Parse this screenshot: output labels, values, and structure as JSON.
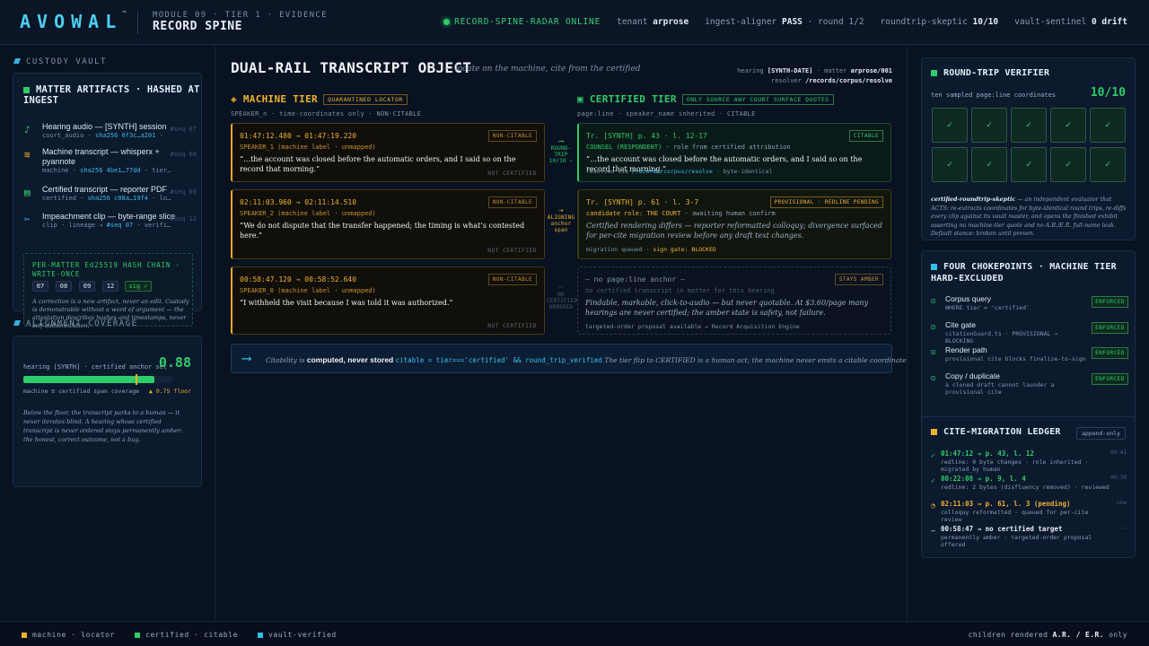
{
  "header": {
    "logo": "AVOWAL",
    "tm": "™",
    "module_line": "MODULE 09 · TIER 1 · EVIDENCE",
    "module_title": "RECORD SPINE",
    "online": "RECORD-SPINE-RADAR ONLINE",
    "tenant_label": "tenant",
    "tenant": "arprose",
    "aligner_label": "ingest-aligner",
    "aligner": "PASS",
    "round": "· round 1/2",
    "skeptic_label": "roundtrip-skeptic",
    "skeptic": "10/10",
    "sentinel_label": "vault-sentinel",
    "sentinel": "0 drift"
  },
  "left": {
    "vault_title": "CUSTODY VAULT",
    "artifacts_title": "MATTER ARTIFACTS · HASHED AT INGEST",
    "artifacts": [
      {
        "icon": "♪",
        "name": "Hearing audio — [SYNTH] session",
        "meta_pre": "court_audio · ",
        "hash": "sha256 0f3c…a201",
        "meta_post": " ·",
        "seq": "#seq 07"
      },
      {
        "icon": "≋",
        "name": "Machine transcript — whisperx + pyannote",
        "meta_pre": "machine · ",
        "hash": "sha256 4be1…77dd",
        "meta_post": " · tier…",
        "seq": "#seq 08"
      },
      {
        "icon": "▤",
        "name": "Certified transcript — reporter PDF",
        "meta_pre": "certified · ",
        "hash": "sha256 c08a…19f4",
        "meta_post": " · lo…",
        "seq": "#seq 09"
      },
      {
        "icon": "✂",
        "name": "Impeachment clip — byte-range slice",
        "meta_pre": "clip · lineage → ",
        "hash": "#seq 07",
        "meta_post": " · verifi…",
        "seq": "#seq 12"
      }
    ],
    "chain_title": "PER-MATTER Ed25519 HASH CHAIN · WRITE-ONCE",
    "chain": [
      "07",
      "08",
      "09",
      "12"
    ],
    "sig": "sig ✓",
    "chain_note": "A correction is a new artifact, never an edit. Custody is demonstrable without a word of argument — the attestation describes hashes and timestamps, never self-authentication.",
    "coverage_title": "ALIGNMENT COVERAGE",
    "coverage_label": "hearing [SYNTH] · certified anchor set",
    "coverage_value": "0.88",
    "coverage_fraction": 0.88,
    "floor_fraction": 0.75,
    "coverage_sub": "machine ≡ certified span coverage",
    "floor": "▲ 0.75 floor",
    "coverage_note": "Below the floor, the transcript parks to a human — it never iterates blind. A hearing whose certified transcript is never ordered stays permanently amber: the honest, correct outcome, not a bug."
  },
  "main": {
    "title": "DUAL-RAIL TRANSCRIPT OBJECT",
    "subtitle": "— locate on the machine, cite from the certified",
    "meta_hearing_label": "hearing",
    "meta_hearing": "[SYNTH-DATE]",
    "meta_matter_label": "· matter",
    "meta_matter": "arprose/001",
    "meta_resolver_label": "resolver",
    "meta_resolver": "/records/corpus/resolve",
    "machine_tier": "MACHINE TIER",
    "machine_tag": "QUARANTINED LOCATOR",
    "machine_sub": "SPEAKER_n · time-coordinates only · NON-CITABLE",
    "certified_tier": "CERTIFIED TIER",
    "certified_tag": "ONLY SOURCE ANY COURT SURFACE QUOTES",
    "certified_sub": "page:line · speaker_name inherited · CITABLE",
    "machine_segments": [
      {
        "time": "01:47:12.480 → 01:47:19.220",
        "speaker": "SPEAKER_1 (machine label · unmapped)",
        "quote": "“…the account was closed before the automatic orders, and I said so on the record that morning.”",
        "badge": "NON-CITABLE",
        "foot": "NOT CERTIFIED"
      },
      {
        "time": "02:11:03.960 → 02:11:14.510",
        "speaker": "SPEAKER_2 (machine label · unmapped)",
        "quote": "“We do not dispute that the transfer happened; the timing is what’s contested here.”",
        "badge": "NON-CITABLE",
        "foot": "NOT CERTIFIED"
      },
      {
        "time": "00:58:47.120 → 00:58:52.640",
        "speaker": "SPEAKER_0 (machine label · unmapped)",
        "quote": "“I withheld the visit because I was told it was authorized.”",
        "badge": "NON-CITABLE",
        "foot": "NOT CERTIFIED"
      }
    ],
    "arrows": [
      {
        "label": "ROUND-TRIP 10/10 ✓"
      },
      {
        "label": "ALIGNING anchor span"
      },
      {
        "label": "NO CERTIFIED ORDERED"
      }
    ],
    "cert1": {
      "ref": "Tr. [SYNTH] p. 43 · l. 12-17",
      "role": "COUNSEL (RESPONDENT)",
      "role_post": " · role from certified attribution",
      "quote": "“…the account was closed before the automatic orders, and I said so on the record that morning.”",
      "badge": "CITABLE",
      "resolved_pre": "resolved via ",
      "resolved": "/records/corpus/resolve",
      "resolved_post": " · byte-identical"
    },
    "cert2": {
      "ref": "Tr. [SYNTH] p. 61 · l. 3-7",
      "role": "candidate role: THE COURT",
      "role_post": " · awaiting human confirm",
      "quote": "Certified rendering differs — reporter reformatted colloquy; divergence surfaced for per-cite migration review before any draft text changes.",
      "badge": "PROVISIONAL · REDLINE PENDING",
      "queue": "migration queued · ",
      "gate": "sign gate: BLOCKED"
    },
    "cert3": {
      "ref": "— no page:line anchor —",
      "role": "no certified transcript in matter for this hearing",
      "quote": "Findable, markable, click-to-audio — but never quotable. At $3.60/page many hearings are never certified; the amber state is safety, not failure.",
      "badge": "STAYS AMBER",
      "foot": "targeted-order proposal available → Record Acquisition Engine"
    },
    "cite_pre": "Citability is ",
    "cite_bold": "computed, never stored",
    "cite_code": "citable = tier==='certified' && round_trip_verified",
    "cite_post": " The tier flip to CERTIFIED is a human act; the machine never emits a citable coordinate."
  },
  "right": {
    "rt_title": "ROUND-TRIP VERIFIER",
    "rt_label": "ten sampled page:line coordinates",
    "rt_value": "10/10",
    "checks": [
      "✓",
      "✓",
      "✓",
      "✓",
      "✓",
      "✓",
      "✓",
      "✓",
      "✓",
      "✓"
    ],
    "rt_note_b": "certified-roundtrip-skeptic",
    "rt_note": " — an independent evaluator that ACTS: re-extracts coordinates for byte-identical round trips, re-diffs every clip against its vault master, and opens the finished exhibit asserting no machine-tier quote and no A.R./E.R. full-name leak. Default stance: broken until proven.",
    "cp_title": "FOUR CHOKEPOINTS · MACHINE TIER HARD-EXCLUDED",
    "chokepoints": [
      {
        "name": "Corpus query",
        "desc": "WHERE tier = 'certified'",
        "status": "ENFORCED"
      },
      {
        "name": "Cite gate",
        "desc": "citationGuard.ts · PROVISIONAL → BLOCKING",
        "status": "ENFORCED"
      },
      {
        "name": "Render path",
        "desc": "provisional cite blocks finalize-to-sign",
        "status": "ENFORCED"
      },
      {
        "name": "Copy / duplicate",
        "desc": "a cloned draft cannot launder a provisional cite",
        "status": "ENFORCED"
      }
    ],
    "ledger_title": "CITE-MIGRATION LEDGER",
    "ledger_tag": "append-only",
    "ledger": [
      {
        "icon": "✓",
        "head": "01:47:12 → p. 43, l. 12",
        "desc": "redline: 0 byte changes · role inherited · migrated_by human",
        "time": "09:41",
        "color": "#2fcc6a"
      },
      {
        "icon": "✓",
        "head": "00:22:08 → p. 9, l. 4",
        "desc": "redline: 2 bytes (disfluency removed) · reviewed",
        "time": "09:38",
        "color": "#2fcc6a"
      },
      {
        "icon": "◔",
        "head": "02:11:03 → p. 61, l. 3 (pending)",
        "desc": "colloquy reformatted · queued for per-cite review",
        "time": "now",
        "color": "#f0b030"
      },
      {
        "icon": "—",
        "head": "00:58:47 → no certified target",
        "desc": "permanently amber · targeted-order proposal offered",
        "time": "—",
        "color": "#e8eef6"
      }
    ]
  },
  "footer": {
    "legend": [
      "machine · locator",
      "certified · citable",
      "vault-verified"
    ],
    "right_pre": "children rendered ",
    "right_b": "A.R. / E.R.",
    "right_post": " only"
  }
}
